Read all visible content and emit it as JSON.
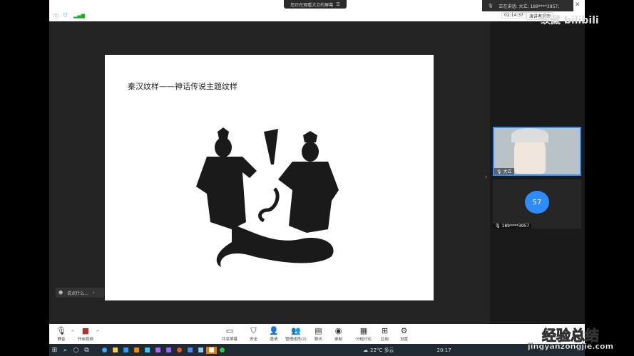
{
  "notice": {
    "text": "您正在观看大立的屏幕",
    "icon": "view-options-icon"
  },
  "speaking": {
    "text": "正在讲话: 大立; 189****3957;"
  },
  "top": {
    "timer": "02:14:37",
    "view": "演讲者视图"
  },
  "slide": {
    "title": "秦汉纹样——神话传说主题纹样"
  },
  "participants": [
    {
      "name": "大立"
    },
    {
      "name": "189****3957",
      "avatar": "57"
    }
  ],
  "chat": {
    "placeholder": "说点什么..."
  },
  "toolbar": {
    "left": [
      {
        "label": "静音",
        "icon": "microphone-icon"
      },
      {
        "label": "开启视频",
        "icon": "video-off-icon"
      }
    ],
    "center": [
      {
        "label": "共享屏幕",
        "icon": "share-screen-icon"
      },
      {
        "label": "安全",
        "icon": "shield-icon"
      },
      {
        "label": "邀请",
        "icon": "invite-icon"
      },
      {
        "label": "管理成员(2)",
        "icon": "participants-icon"
      },
      {
        "label": "聊天",
        "icon": "chat-icon"
      },
      {
        "label": "录制",
        "icon": "record-icon"
      },
      {
        "label": "分组讨论",
        "icon": "breakout-icon"
      },
      {
        "label": "应用",
        "icon": "apps-icon"
      },
      {
        "label": "设置",
        "icon": "gear-icon"
      }
    ]
  },
  "taskbar": {
    "weather": "22°C 多云",
    "time": "20:17"
  },
  "watermarks": {
    "top": "纹藏 bilibili",
    "bottom_cn": "经验总结",
    "bottom_url": "jingyanzongjie.com"
  },
  "colors": {
    "accent": "#2d8cff"
  }
}
